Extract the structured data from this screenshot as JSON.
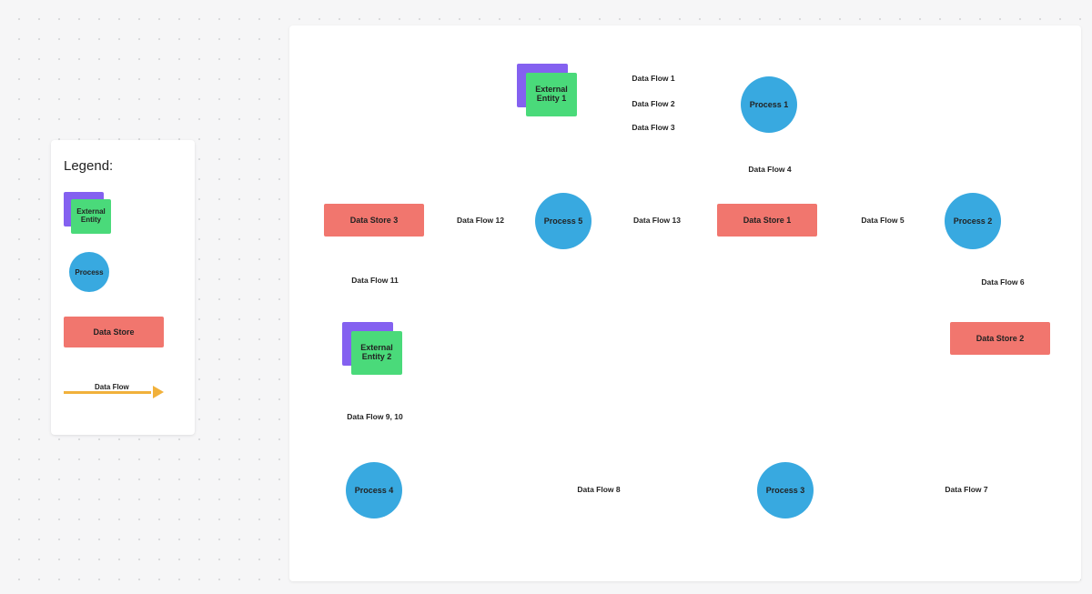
{
  "legend": {
    "title": "Legend:",
    "entity_label": "External Entity",
    "process_label": "Process",
    "datastore_label": "Data Store",
    "flow_label": "Data Flow"
  },
  "nodes": {
    "entity1": "External Entity 1",
    "entity2": "External Entity 2",
    "process1": "Process 1",
    "process2": "Process 2",
    "process3": "Process 3",
    "process4": "Process 4",
    "process5": "Process 5",
    "datastore1": "Data Store 1",
    "datastore2": "Data Store 2",
    "datastore3": "Data Store 3"
  },
  "flows": {
    "f1": "Data Flow 1",
    "f2": "Data Flow 2",
    "f3": "Data Flow 3",
    "f4": "Data Flow 4",
    "f5": "Data Flow 5",
    "f6": "Data Flow 6",
    "f7": "Data Flow 7",
    "f8": "Data Flow 8",
    "f9_10": "Data Flow 9, 10",
    "f11": "Data Flow 11",
    "f12": "Data Flow 12",
    "f13": "Data Flow 13"
  },
  "colors": {
    "arrow": "#f1b13b",
    "process": "#38a9e0",
    "entity_back": "#8461f0",
    "entity_front": "#4ada7a",
    "datastore": "#f1766e"
  }
}
